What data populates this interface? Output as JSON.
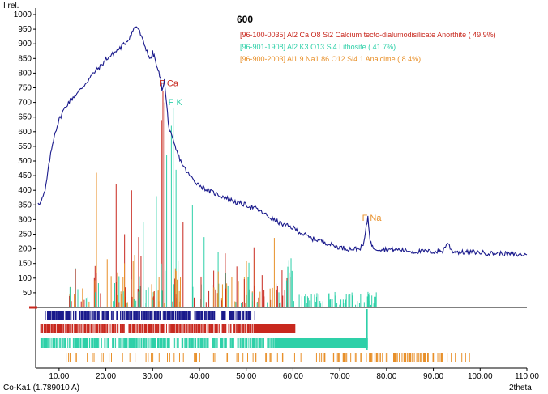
{
  "chart_data": {
    "type": "line",
    "title": "600",
    "ylabel": "I rel.",
    "xlabel": "2theta",
    "radiation": "Co-Ka1 (1.789010 A)",
    "xlim": [
      5,
      110
    ],
    "ylim": [
      0,
      1000
    ],
    "xticks": [
      "10.00",
      "20.00",
      "30.00",
      "40.00",
      "50.00",
      "60.00",
      "70.00",
      "80.00",
      "90.00",
      "100.00",
      "110.00"
    ],
    "yticks": [
      "50",
      "100",
      "150",
      "200",
      "250",
      "300",
      "350",
      "400",
      "450",
      "500",
      "550",
      "600",
      "650",
      "700",
      "750",
      "800",
      "850",
      "900",
      "950",
      "1000"
    ],
    "colors": {
      "pattern": "#1a1a8c",
      "anorthite": "#c8281e",
      "lithosite": "#2ed0a8",
      "analcime": "#e8902a",
      "axis": "#000000"
    },
    "legend": [
      {
        "text": "[96-100-0035] Al2 Ca O8 Si2  Calcium tecto-dialumodisilicate Anorthite ( 49.9%)",
        "color": "#c8281e"
      },
      {
        "text": "[96-901-1908] Al2 K3 O13 Si4  Lithosite ( 41.7%)",
        "color": "#2ed0a8"
      },
      {
        "text": "[96-900-2003] Al1.9 Na1.86 O12 Si4.1  Analcime ( 8.4%)",
        "color": "#e8902a"
      }
    ],
    "annotations": [
      {
        "text": "F Ca",
        "x": 32.4,
        "y": 755,
        "color": "#c8281e"
      },
      {
        "text": "F K",
        "x": 34.4,
        "y": 690,
        "color": "#2ed0a8"
      },
      {
        "text": "F Na",
        "x": 75.8,
        "y": 295,
        "color": "#e8902a"
      }
    ],
    "series": [
      {
        "name": "pattern",
        "x": [
          5.5,
          6,
          7,
          8,
          9,
          10,
          11,
          12,
          13,
          14,
          15,
          16,
          17,
          18,
          19,
          20,
          21,
          22,
          23,
          24,
          25,
          26,
          26.5,
          27,
          28,
          29,
          29.5,
          30,
          30.5,
          31,
          31.5,
          32,
          32.5,
          33,
          33.5,
          34,
          35,
          36,
          37,
          38,
          39,
          40,
          42,
          44,
          46,
          48,
          50,
          52,
          54,
          56,
          58,
          60,
          62,
          64,
          66,
          68,
          70,
          72,
          74,
          75,
          75.5,
          76,
          76.5,
          77,
          78,
          80,
          82,
          84,
          86,
          88,
          90,
          92,
          93,
          94,
          96,
          98,
          100,
          102,
          104,
          106,
          108,
          110
        ],
        "y": [
          360,
          355,
          395,
          505,
          590,
          640,
          675,
          700,
          718,
          733,
          752,
          772,
          792,
          812,
          825,
          848,
          858,
          872,
          885,
          900,
          920,
          952,
          960,
          950,
          905,
          868,
          845,
          870,
          850,
          812,
          795,
          745,
          775,
          690,
          612,
          585,
          538,
          500,
          470,
          448,
          432,
          418,
          398,
          385,
          372,
          358,
          350,
          338,
          318,
          298,
          282,
          272,
          252,
          235,
          228,
          215,
          205,
          200,
          200,
          210,
          255,
          310,
          228,
          205,
          200,
          198,
          198,
          195,
          190,
          192,
          190,
          192,
          222,
          192,
          188,
          190,
          188,
          185,
          185,
          182,
          180,
          180
        ]
      }
    ]
  }
}
